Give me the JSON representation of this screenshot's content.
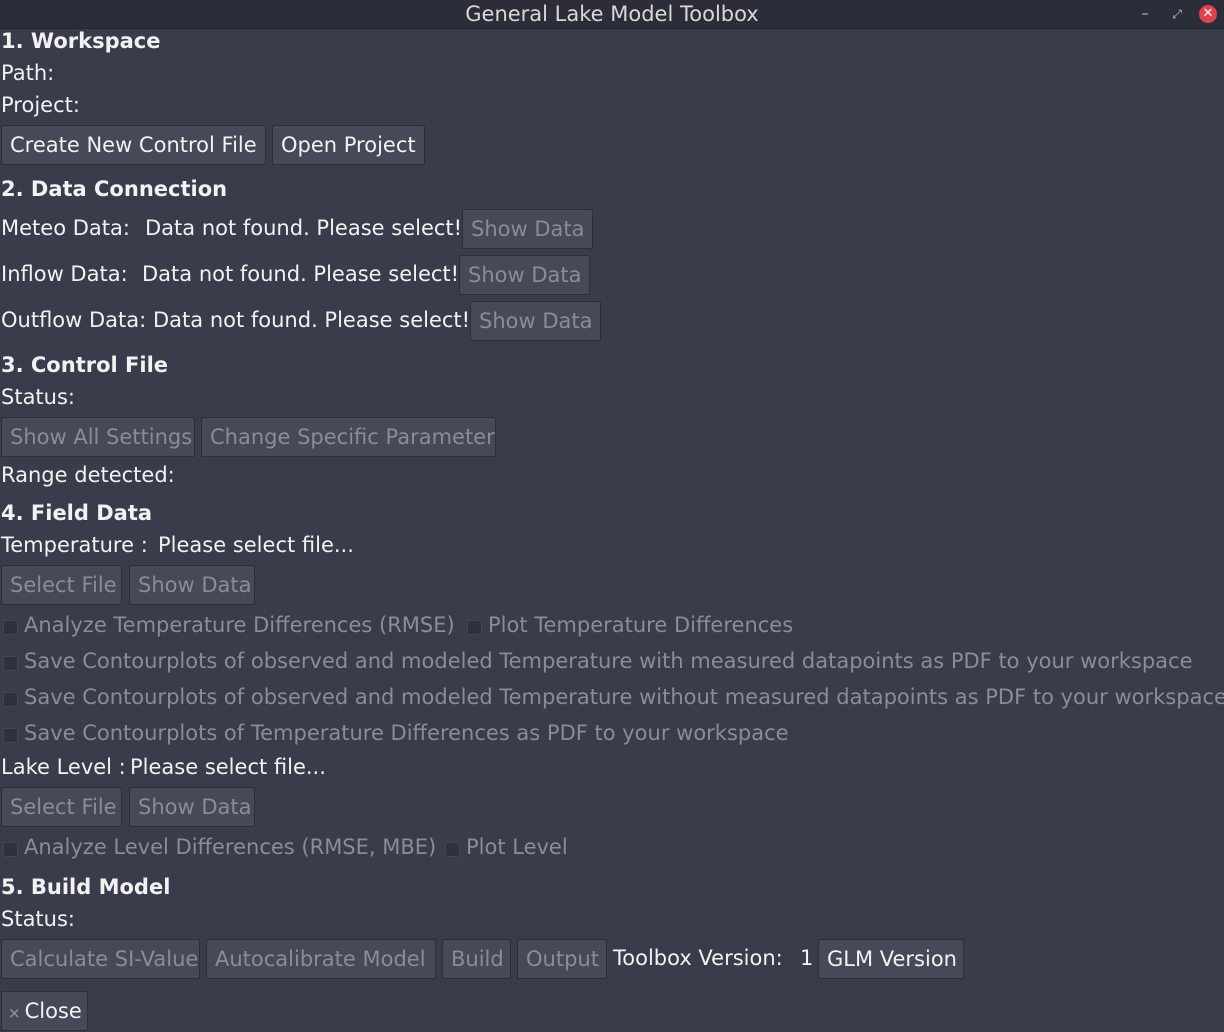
{
  "window": {
    "title": "General Lake Model Toolbox",
    "controls": {
      "minimize": "–",
      "maximize": "⤢",
      "close": "✕"
    }
  },
  "workspace": {
    "heading": "1. Workspace",
    "path_label": "Path:",
    "project_label": "Project:",
    "create_button": "Create New Control File",
    "open_button": "Open Project"
  },
  "data_connection": {
    "heading": "2. Data Connection",
    "rows": [
      {
        "label": "Meteo Data:",
        "status": "Data not found. Please select!",
        "button": "Show  Data"
      },
      {
        "label": "Inflow Data:",
        "status": "Data not found. Please select!",
        "button": "Show  Data"
      },
      {
        "label": "Outflow Data:",
        "status": "Data not found. Please select!",
        "button": "Show  Data"
      }
    ]
  },
  "control_file": {
    "heading": "3. Control File",
    "status_label": "Status:",
    "show_all_button": "Show All Settings",
    "change_param_button": "Change Specific Parameter",
    "range_label": "Range detected:"
  },
  "field_data": {
    "heading": "4. Field Data",
    "temperature": {
      "label": "Temperature :",
      "file_status": "Please select file...",
      "select_button": "Select File",
      "show_button": "Show Data",
      "options": [
        "Analyze Temperature Differences (RMSE)",
        "Plot Temperature Differences",
        "Save Contourplots of observed and modeled Temperature with measured datapoints as PDF to your workspace",
        "Save Contourplots of observed and modeled Temperature without measured datapoints as PDF to your workspace",
        "Save Contourplots of Temperature Differences as PDF to your workspace"
      ]
    },
    "lake_level": {
      "label": "Lake Level :",
      "file_status": "Please select file...",
      "select_button": "Select File",
      "show_button": "Show Data",
      "options": [
        "Analyze Level Differences (RMSE, MBE)",
        "Plot Level"
      ]
    }
  },
  "build_model": {
    "heading": "5. Build Model",
    "status_label": "Status:",
    "si_button": "Calculate SI-Value",
    "autocal_button": "Autocalibrate Model",
    "build_button": "Build",
    "output_button": "Output",
    "toolbox_version_label": "Toolbox Version:",
    "toolbox_version_value": "1",
    "glm_button": "GLM Version"
  },
  "footer": {
    "close_icon": "×",
    "close_button": "Close"
  }
}
